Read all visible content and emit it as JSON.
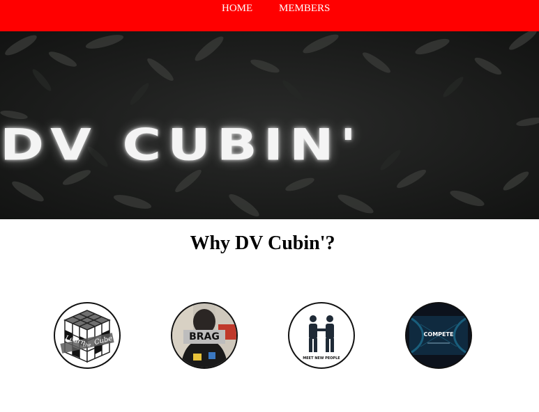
{
  "nav": {
    "items": [
      {
        "label": "HOME"
      },
      {
        "label": "MEMBERS"
      }
    ],
    "background": "#ff0000"
  },
  "hero": {
    "title": "DV CUBIN'"
  },
  "section": {
    "heading": "Why DV Cubin'?"
  },
  "features": [
    {
      "icon": "learn-cube-icon",
      "top_text": "Learn",
      "mid_text": "the",
      "bottom_text": "Cube"
    },
    {
      "icon": "brag-icon",
      "text": "BRAG"
    },
    {
      "icon": "meet-people-icon",
      "text": "MEET NEW PEOPLE"
    },
    {
      "icon": "compete-icon",
      "text": "COMPETE"
    }
  ]
}
